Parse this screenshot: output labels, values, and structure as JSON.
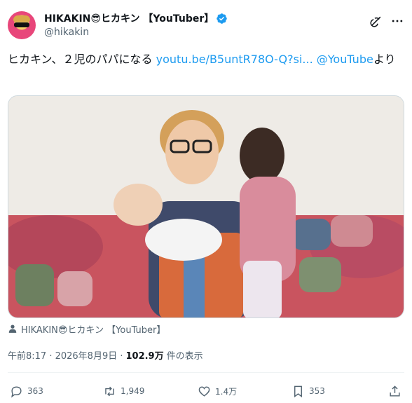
{
  "author": {
    "display_name": "HIKAKIN😎ヒカキン 【YouTuber】",
    "handle": "@hikakin"
  },
  "icons": {
    "verified": "verified-badge-icon",
    "grok": "grok-icon",
    "more": "more-icon",
    "person": "person-icon",
    "reply": "reply-icon",
    "repost": "repost-icon",
    "like": "like-icon",
    "bookmark": "bookmark-icon",
    "share": "share-icon"
  },
  "colors": {
    "link": "#1d9bf0",
    "verified": "#1d9bf0",
    "muted": "#536471"
  },
  "tweet": {
    "text_prefix": "ヒカキン、２児のパパになる ",
    "link_url": "youtu.be/B5untR78O-Q?si...",
    "space": " ",
    "mention": "@YouTube",
    "text_suffix": "より"
  },
  "media": {
    "tagged_user": "HIKAKIN😎ヒカキン 【YouTuber】"
  },
  "meta": {
    "time": "午前8:17 · 2026年8月9日 · ",
    "views": "102.9万",
    "views_label": " 件の表示"
  },
  "actions": {
    "replies": "363",
    "reposts": "1,949",
    "likes": "1.4万",
    "bookmarks": "353"
  }
}
